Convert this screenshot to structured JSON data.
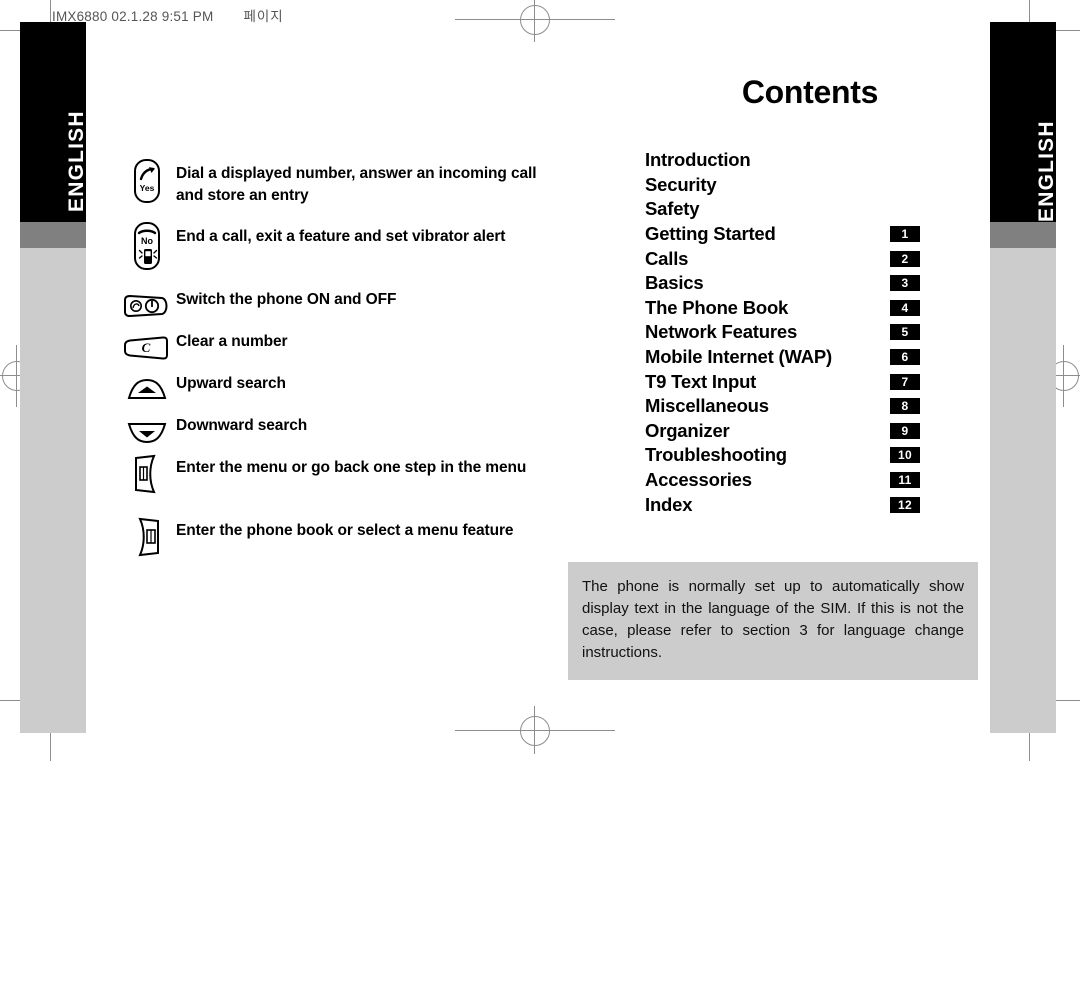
{
  "scan_header": {
    "file_stamp": "IMX6880  02.1.28 9:51 PM",
    "korean_label": "페이지"
  },
  "side_tabs": {
    "left_label": "ENGLISH",
    "right_label": "ENGLISH"
  },
  "colors": {
    "tab_black": "#000000",
    "tab_gray": "#808080",
    "tab_light_gray": "#cccccc",
    "note_bg": "#cccccc",
    "badge_bg": "#000000",
    "badge_text": "#ffffff",
    "crop_mark": "#8d8d8d"
  },
  "contents": {
    "title": "Contents",
    "entries": [
      {
        "label": "Introduction",
        "badge": ""
      },
      {
        "label": "Security",
        "badge": ""
      },
      {
        "label": "Safety",
        "badge": ""
      },
      {
        "label": "Getting Started",
        "badge": "1"
      },
      {
        "label": "Calls",
        "badge": "2"
      },
      {
        "label": "Basics",
        "badge": "3"
      },
      {
        "label": "The Phone Book",
        "badge": "4"
      },
      {
        "label": "Network Features",
        "badge": "5"
      },
      {
        "label": "Mobile Internet (WAP)",
        "badge": "6"
      },
      {
        "label": "T9 Text Input",
        "badge": "7"
      },
      {
        "label": "Miscellaneous",
        "badge": "8"
      },
      {
        "label": "Organizer",
        "badge": "9"
      },
      {
        "label": "Troubleshooting",
        "badge": "10"
      },
      {
        "label": "Accessories",
        "badge": "11"
      },
      {
        "label": "Index",
        "badge": "12"
      }
    ]
  },
  "note": {
    "text": "The phone is normally set up to automatically show display text in the language of the SIM. If this is not the case, please refer to section 3 for language change instructions."
  },
  "key_legend": [
    {
      "icon": "yes-call-key-icon",
      "icon_label": "Yes",
      "description": "Dial a displayed number, answer an incoming call and store an entry"
    },
    {
      "icon": "no-end-call-key-icon",
      "icon_label": "No",
      "description": "End a call, exit a feature and set vibrator alert"
    },
    {
      "icon": "power-key-icon",
      "icon_label": "",
      "description": "Switch the phone ON and OFF"
    },
    {
      "icon": "clear-key-icon",
      "icon_label": "C",
      "description": "Clear a number"
    },
    {
      "icon": "up-arrow-key-icon",
      "icon_label": "",
      "description": "Upward search"
    },
    {
      "icon": "down-arrow-key-icon",
      "icon_label": "",
      "description": "Downward search"
    },
    {
      "icon": "left-soft-key-icon",
      "icon_label": "",
      "description": "Enter the menu or go back one step in the menu"
    },
    {
      "icon": "right-soft-key-icon",
      "icon_label": "",
      "description": "Enter the phone book or select a menu feature"
    }
  ]
}
